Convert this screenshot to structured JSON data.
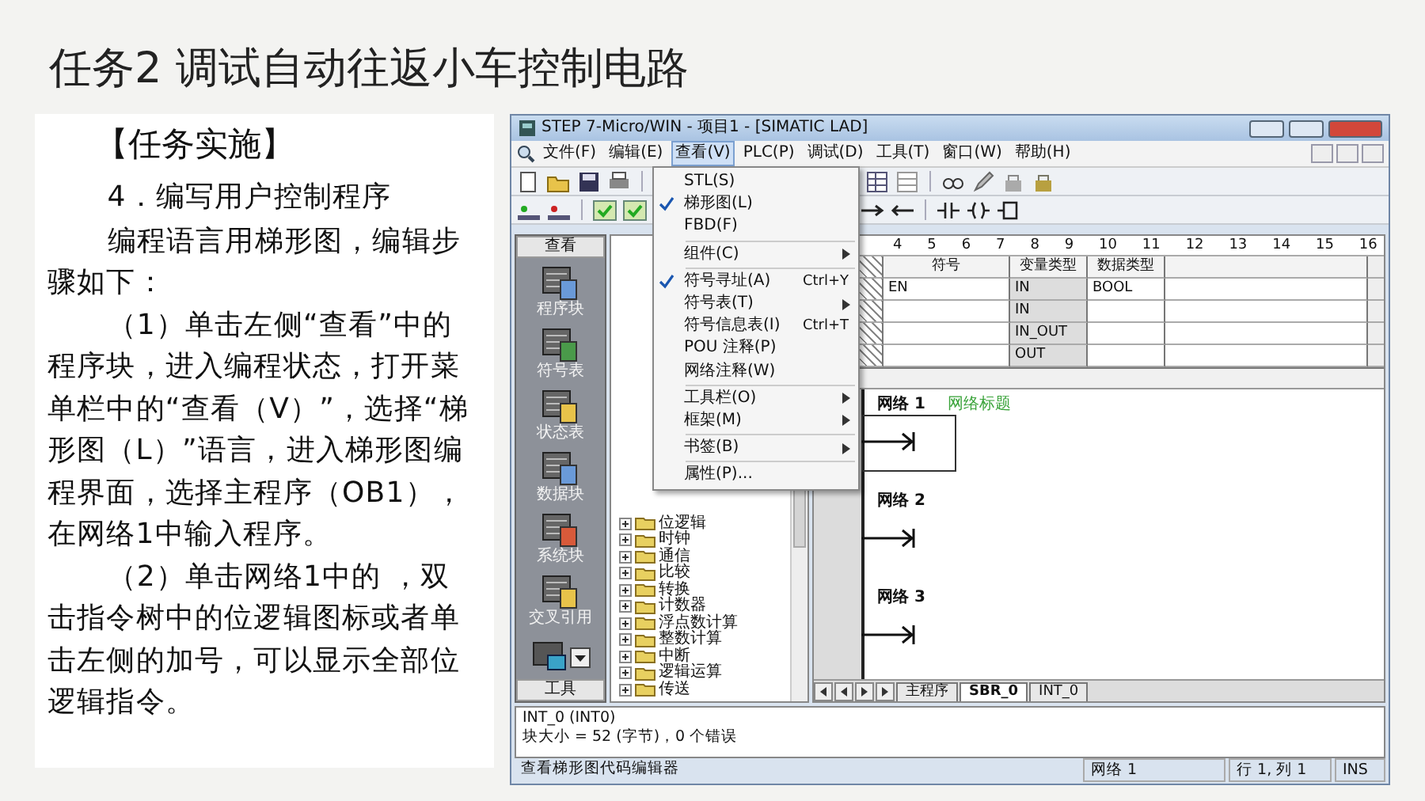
{
  "title": "任务2 调试自动往返小车控制电路",
  "task_card": {
    "heading": "【任务实施】",
    "paragraphs": [
      {
        "kind": "subheading",
        "text": "4．编写用户控制程序"
      },
      {
        "kind": "body",
        "text": "编程语言用梯形图，编辑步骤如下："
      },
      {
        "kind": "body",
        "text": "（1）单击左侧“查看”中的程序块，进入编程状态，打开菜单栏中的“查看（V）”，选择“梯形图（L）”语言，进入梯形图编程界面，选择主程序（OB1），在网络1中输入程序。"
      },
      {
        "kind": "body",
        "text": "（2）单击网络1中的 ，双击指令树中的位逻辑图标或者单击左侧的加号，可以显示全部位逻辑指令。"
      }
    ]
  },
  "app_window": {
    "title": "STEP 7-Micro/WIN - 项目1 - [SIMATIC LAD]",
    "menu": [
      {
        "label": "文件(F)",
        "selected": false
      },
      {
        "label": "编辑(E)",
        "selected": false
      },
      {
        "label": "查看(V)",
        "selected": true
      },
      {
        "label": "PLC(P)",
        "selected": false
      },
      {
        "label": "调试(D)",
        "selected": false
      },
      {
        "label": "工具(T)",
        "selected": false
      },
      {
        "label": "窗口(W)",
        "selected": false
      },
      {
        "label": "帮助(H)",
        "selected": false
      }
    ],
    "view_menu": [
      {
        "kind": "item",
        "label": "STL(S)",
        "checked": false
      },
      {
        "kind": "item",
        "label": "梯形图(L)",
        "checked": true
      },
      {
        "kind": "item",
        "label": "FBD(F)",
        "checked": false
      },
      {
        "kind": "separator"
      },
      {
        "kind": "submenu",
        "label": "组件(C)"
      },
      {
        "kind": "separator"
      },
      {
        "kind": "item",
        "label": "符号寻址(A)",
        "shortcut": "Ctrl+Y",
        "checked": true
      },
      {
        "kind": "submenu",
        "label": "符号表(T)"
      },
      {
        "kind": "item",
        "label": "符号信息表(I)",
        "shortcut": "Ctrl+T",
        "checked": false
      },
      {
        "kind": "item",
        "label": "POU 注释(P)",
        "checked": false
      },
      {
        "kind": "item",
        "label": "网络注释(W)",
        "checked": false
      },
      {
        "kind": "separator"
      },
      {
        "kind": "submenu",
        "label": "工具栏(O)"
      },
      {
        "kind": "submenu",
        "label": "框架(M)"
      },
      {
        "kind": "separator"
      },
      {
        "kind": "submenu",
        "label": "书签(B)"
      },
      {
        "kind": "separator"
      },
      {
        "kind": "item",
        "label": "属性(P)...",
        "checked": false
      }
    ],
    "navigation": {
      "header": "查看",
      "items": [
        "程序块",
        "符号表",
        "状态表",
        "数据块",
        "系统块",
        "交叉引用"
      ],
      "footer": "工具"
    },
    "instruction_tree": [
      "位逻辑",
      "时钟",
      "通信",
      "比较",
      "转换",
      "计数器",
      "浮点数计算",
      "整数计算",
      "中断",
      "逻辑运算",
      "传送"
    ],
    "ruler": [
      "4",
      "5",
      "6",
      "7",
      "8",
      "9",
      "10",
      "11",
      "12",
      "13",
      "14",
      "15",
      "16"
    ],
    "variable_table": {
      "columns": [
        "符号",
        "变量类型",
        "数据类型"
      ],
      "rows": [
        {
          "symbol": "EN",
          "var_type": "IN",
          "data_type": "BOOL"
        },
        {
          "var_type": "IN"
        },
        {
          "var_type": "IN_OUT"
        },
        {
          "var_type": "OUT"
        }
      ]
    },
    "networks": [
      {
        "label": "网络 1",
        "title": "网络标题",
        "selected": true
      },
      {
        "label": "网络 2",
        "selected": false
      },
      {
        "label": "网络 3",
        "selected": false
      }
    ],
    "tabs": [
      {
        "label": "主程序",
        "selected": false
      },
      {
        "label": "SBR_0",
        "selected": true
      },
      {
        "label": "INT_0",
        "selected": false
      }
    ],
    "output": [
      "INT_0 (INT0)",
      "块大小 = 52 (字节)，0 个错误"
    ],
    "status_bar": [
      "查看梯形图代码编辑器",
      "网络 1",
      "行 1, 列 1",
      "INS"
    ]
  }
}
